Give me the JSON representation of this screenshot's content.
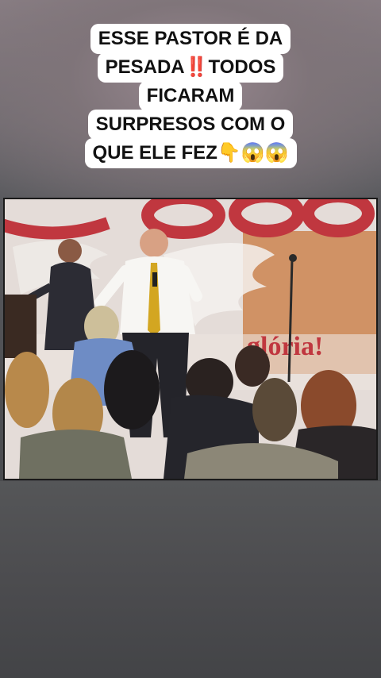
{
  "caption": {
    "lines": [
      "ESSE PASTOR É DA",
      "PESADA‼️TODOS",
      "FICARAM",
      "SURPRESOS COM O",
      "QUE ELE FEZ👇😱😱"
    ]
  },
  "video": {
    "banner_text": "glória!"
  },
  "colors": {
    "caption_bg": "#ffffff",
    "caption_text": "#111111",
    "banner_red": "#c0373f"
  }
}
